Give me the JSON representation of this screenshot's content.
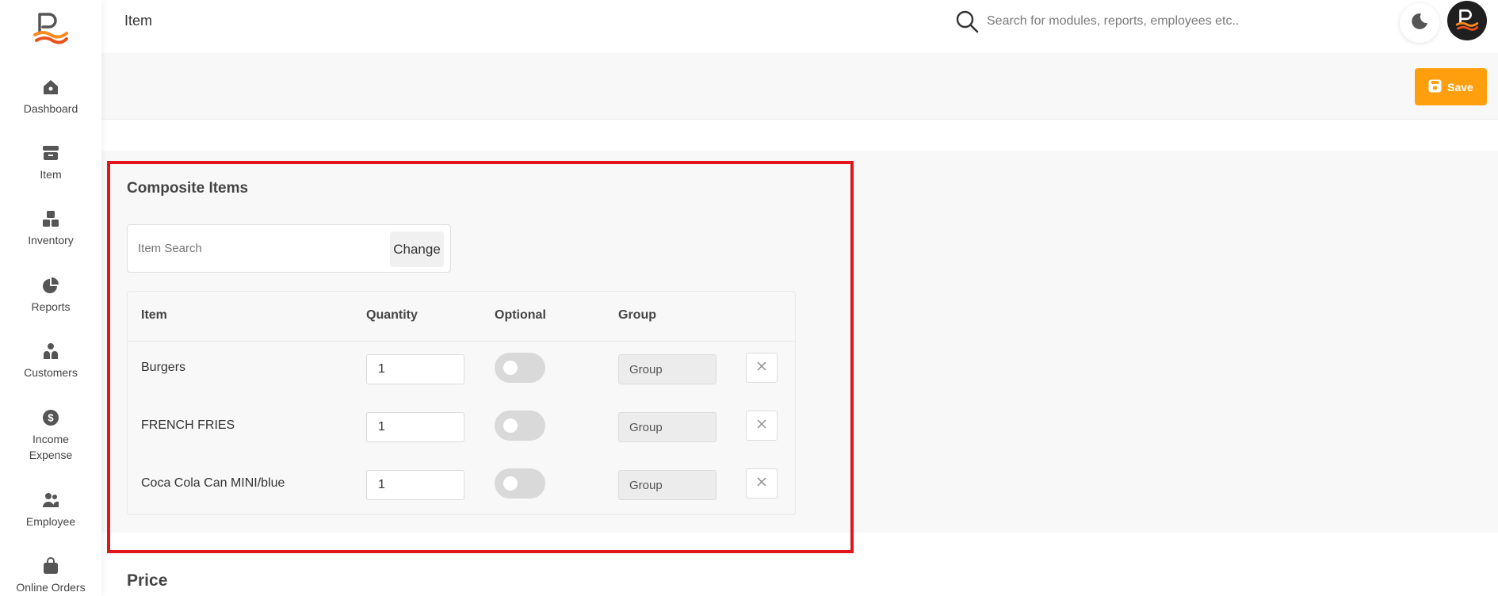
{
  "app": {
    "brand_color": "#ff9f0e",
    "highlight_color": "#e0161c"
  },
  "sidebar": {
    "items": [
      {
        "label": "Dashboard",
        "icon": "home-icon"
      },
      {
        "label": "Item",
        "icon": "archive-box-icon"
      },
      {
        "label": "Inventory",
        "icon": "boxes-icon"
      },
      {
        "label": "Reports",
        "icon": "pie-chart-icon"
      },
      {
        "label": "Customers",
        "icon": "users-icon"
      },
      {
        "label": "Income",
        "label2": "Expense",
        "icon": "dollar-circle-icon"
      },
      {
        "label": "Employee",
        "icon": "user-group-icon"
      },
      {
        "label": "Online Orders",
        "icon": "shopping-bag-icon"
      }
    ]
  },
  "header": {
    "title": "Item",
    "search_placeholder": "Search for modules, reports, employees etc.."
  },
  "toolbar": {
    "save_label": "Save"
  },
  "composite": {
    "title": "Composite Items",
    "search_placeholder": "Item Search",
    "change_label": "Change",
    "columns": {
      "item": "Item",
      "quantity": "Quantity",
      "optional": "Optional",
      "group": "Group"
    },
    "group_placeholder": "Group",
    "rows": [
      {
        "name": "Burgers",
        "quantity": "1",
        "optional": false
      },
      {
        "name": "FRENCH FRIES",
        "quantity": "1",
        "optional": false
      },
      {
        "name": "Coca Cola Can MINI/blue",
        "quantity": "1",
        "optional": false
      }
    ]
  },
  "price": {
    "title": "Price"
  }
}
